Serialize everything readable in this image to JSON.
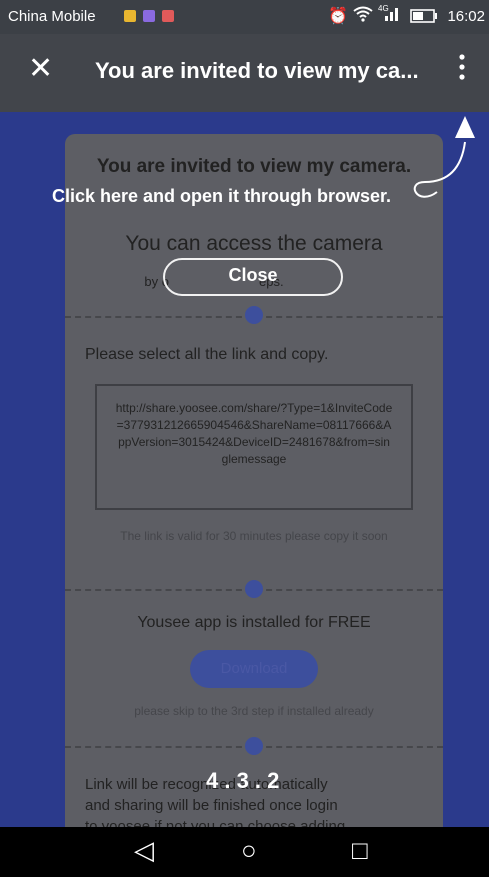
{
  "status_bar": {
    "carrier": "China Mobile",
    "time": "16:02",
    "network": "4G"
  },
  "app_bar": {
    "title": "You are invited to view my ca...",
    "close_glyph": "✕",
    "more_glyph": "⋮"
  },
  "overlay": {
    "hint_line1": "Click here and open it through browser.",
    "close_label": "Close",
    "countdown": "4 . 3 . 2"
  },
  "page": {
    "heading": "You are invited to view my camera.",
    "subheading": "You can access the camera",
    "steps_hint": "by o",
    "steps_hint_end": "eps.",
    "step1_text": "Please select all the link and copy.",
    "link": "http://share.yoosee.com/share/?Type=1&InviteCode=377931212665904546&ShareName=08117666&AppVersion=3015424&DeviceID=2481678&from=singlemessage",
    "link_validity": "The link is valid for 30 minutes please copy it soon",
    "step2_text": "Yousee app is installed for FREE",
    "download_label": "Download",
    "skip_text": "please skip to the 3rd step if installed already",
    "step3_line1": "Link will be recognized automatically",
    "step3_line2": "and sharing will be finished once login",
    "step3_line3": "to yoosee if not you can choose adding"
  },
  "nav_bar": {
    "back": "◁",
    "home": "○",
    "recents": "□"
  }
}
